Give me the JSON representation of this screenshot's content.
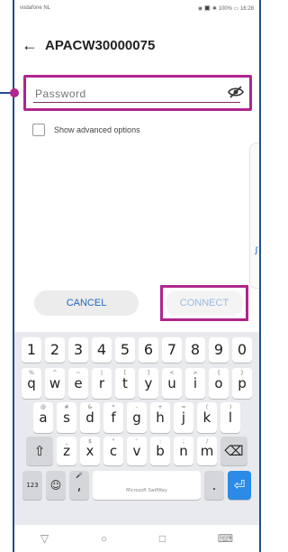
{
  "status": {
    "carrier": "vodafone NL",
    "right": "◉ 🔳 ✱ 100% ▭ 16:28"
  },
  "appbar": {
    "back_glyph": "←",
    "title": "APACW30000075"
  },
  "password": {
    "placeholder": "Password",
    "value": ""
  },
  "advanced": {
    "label": "Show advanced options"
  },
  "side": {
    "glyph": "∫"
  },
  "buttons": {
    "cancel": "CANCEL",
    "connect": "CONNECT"
  },
  "keyboard": {
    "numbers": [
      "1",
      "2",
      "3",
      "4",
      "5",
      "6",
      "7",
      "8",
      "9",
      "0"
    ],
    "row1": [
      {
        "k": "q",
        "s": "%"
      },
      {
        "k": "w",
        "s": "^"
      },
      {
        "k": "e",
        "s": "~"
      },
      {
        "k": "r",
        "s": "|"
      },
      {
        "k": "t",
        "s": "["
      },
      {
        "k": "y",
        "s": "]"
      },
      {
        "k": "u",
        "s": "<"
      },
      {
        "k": "i",
        "s": ">"
      },
      {
        "k": "o",
        "s": "{"
      },
      {
        "k": "p",
        "s": "}"
      }
    ],
    "row2": [
      {
        "k": "a",
        "s": "@"
      },
      {
        "k": "s",
        "s": "#"
      },
      {
        "k": "d",
        "s": "&"
      },
      {
        "k": "f",
        "s": "*"
      },
      {
        "k": "g",
        "s": "-"
      },
      {
        "k": "h",
        "s": "+"
      },
      {
        "k": "j",
        "s": "="
      },
      {
        "k": "k",
        "s": "("
      },
      {
        "k": "l",
        "s": ")"
      }
    ],
    "row3": [
      {
        "k": "z",
        "s": "_"
      },
      {
        "k": "x",
        "s": "$"
      },
      {
        "k": "c",
        "s": "\""
      },
      {
        "k": "v",
        "s": "'"
      },
      {
        "k": "b",
        "s": ":"
      },
      {
        "k": "n",
        "s": ";"
      },
      {
        "k": "m",
        "s": "/"
      }
    ],
    "shift": "⇧",
    "backspace": "⌫",
    "sym_label": "123",
    "emoji": "☺",
    "mic": "🎤",
    "comma": ",",
    "space_label": "Microsoft SwiftKey",
    "period": ".",
    "enter": "⏎"
  },
  "nav": {
    "back": "▽",
    "home": "○",
    "recents": "□",
    "keyboard": "⌨"
  }
}
